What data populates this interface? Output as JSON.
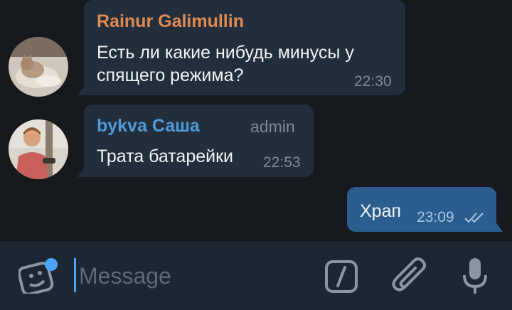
{
  "messages": [
    {
      "sender": "Rainur Galimullin",
      "text_line1": "Есть ли какие нибудь минусы у",
      "text_line2": "спящего режима?",
      "time": "22:30",
      "sender_color": "#e08a52"
    },
    {
      "sender": "bykva Саша",
      "role": "admin",
      "text": "Трата батарейки",
      "time": "22:53",
      "sender_color": "#4f9bd9"
    },
    {
      "text": "Храп",
      "time": "23:09",
      "read_status": "double-check-icon"
    }
  ],
  "composer": {
    "placeholder": "Message",
    "icons": [
      "sticker-icon",
      "bot-command-icon",
      "attach-icon",
      "microphone-icon"
    ],
    "accent": "#4ea4f6"
  }
}
